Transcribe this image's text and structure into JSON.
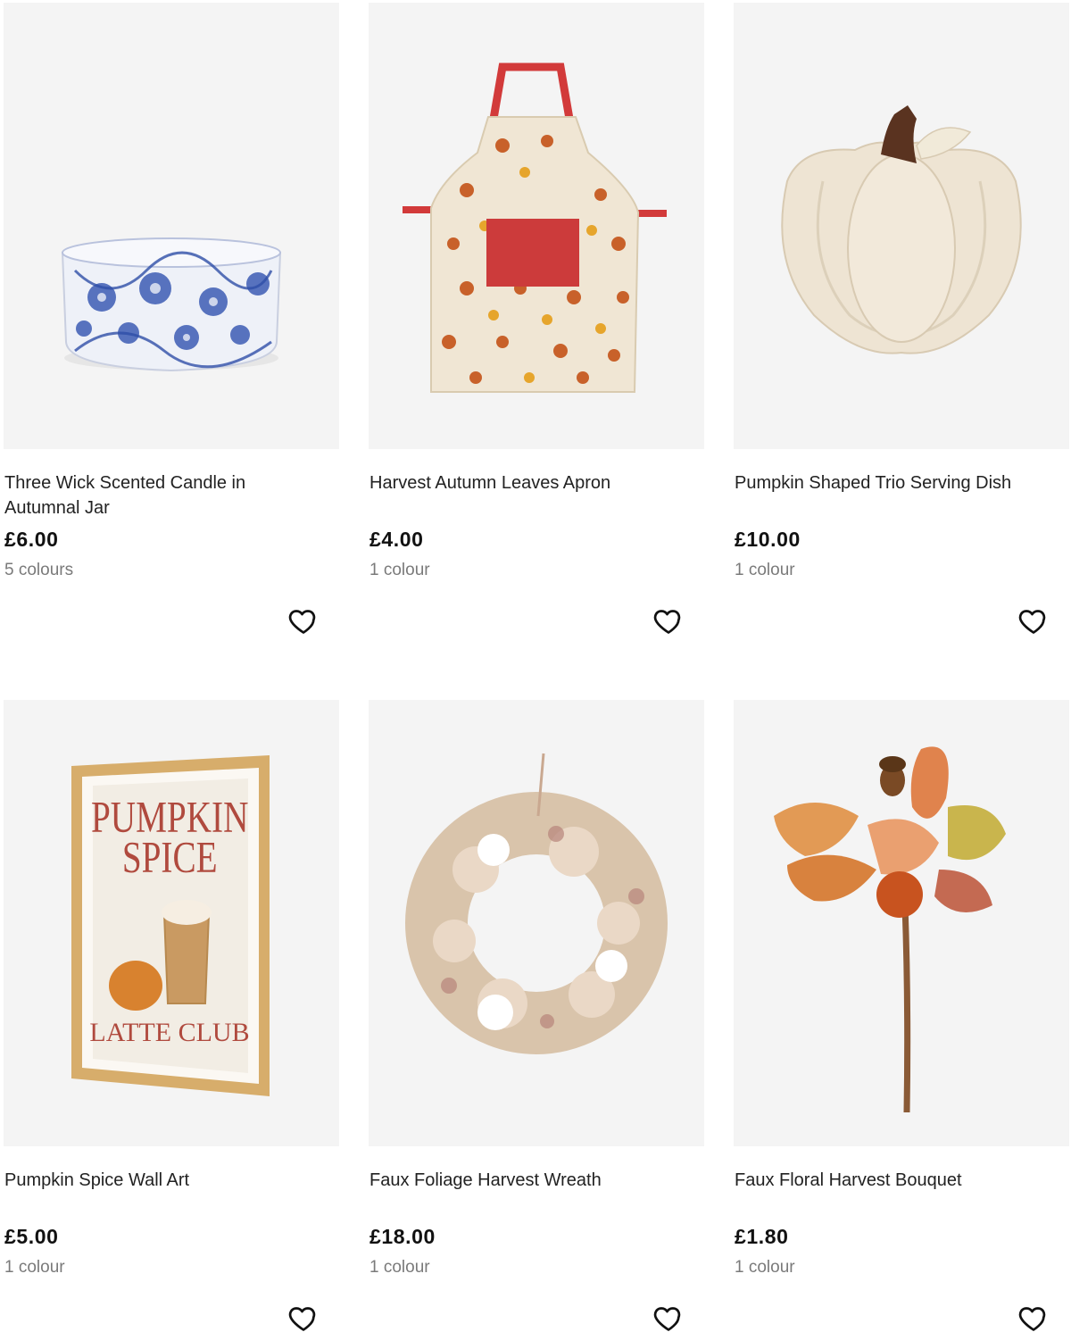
{
  "products": [
    {
      "title": "Three Wick Scented Candle in Autumnal Jar",
      "price": "£6.00",
      "colours": "5 colours"
    },
    {
      "title": "Harvest Autumn Leaves Apron",
      "price": "£4.00",
      "colours": "1 colour"
    },
    {
      "title": "Pumpkin Shaped Trio Serving Dish",
      "price": "£10.00",
      "colours": "1 colour"
    },
    {
      "title": "Pumpkin Spice Wall Art",
      "price": "£5.00",
      "colours": "1 colour",
      "artwork_text": [
        "PUMPKIN",
        "SPICE",
        "LATTE CLUB"
      ]
    },
    {
      "title": "Faux Foliage Harvest Wreath",
      "price": "£18.00",
      "colours": "1 colour"
    },
    {
      "title": "Faux Floral Harvest Bouquet",
      "price": "£1.80",
      "colours": "1 colour"
    }
  ],
  "icons": {
    "wishlist": "heart-outline-icon"
  },
  "colors": {
    "image_bg": "#f4f4f4",
    "price": "#111111",
    "muted": "#7a7a7a"
  }
}
